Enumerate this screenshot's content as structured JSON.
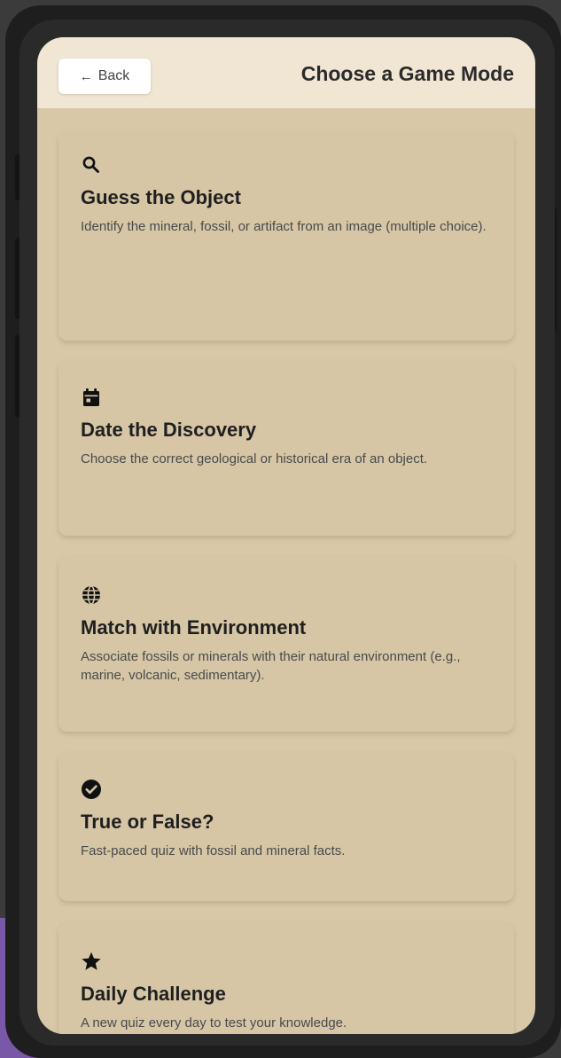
{
  "header": {
    "back_label": "Back",
    "back_arrow": "←",
    "title": "Choose a Game Mode"
  },
  "modes": [
    {
      "icon": "search-icon",
      "title": "Guess the Object",
      "description": "Identify the mineral, fossil, or artifact from an image (multiple choice)."
    },
    {
      "icon": "calendar-icon",
      "title": "Date the Discovery",
      "description": "Choose the correct geological or historical era of an object."
    },
    {
      "icon": "globe-icon",
      "title": "Match with Environment",
      "description": "Associate fossils or minerals with their natural environment (e.g., marine, volcanic, sedimentary)."
    },
    {
      "icon": "check-circle-icon",
      "title": "True or False?",
      "description": "Fast-paced quiz with fossil and mineral facts."
    },
    {
      "icon": "star-icon",
      "title": "Daily Challenge",
      "description": "A new quiz every day to test your knowledge."
    }
  ],
  "colors": {
    "header_bg": "#f0e6d3",
    "screen_bg": "#d8c8a8",
    "card_bg": "#d6c6a6",
    "accent_purple": "#7a58a8"
  }
}
